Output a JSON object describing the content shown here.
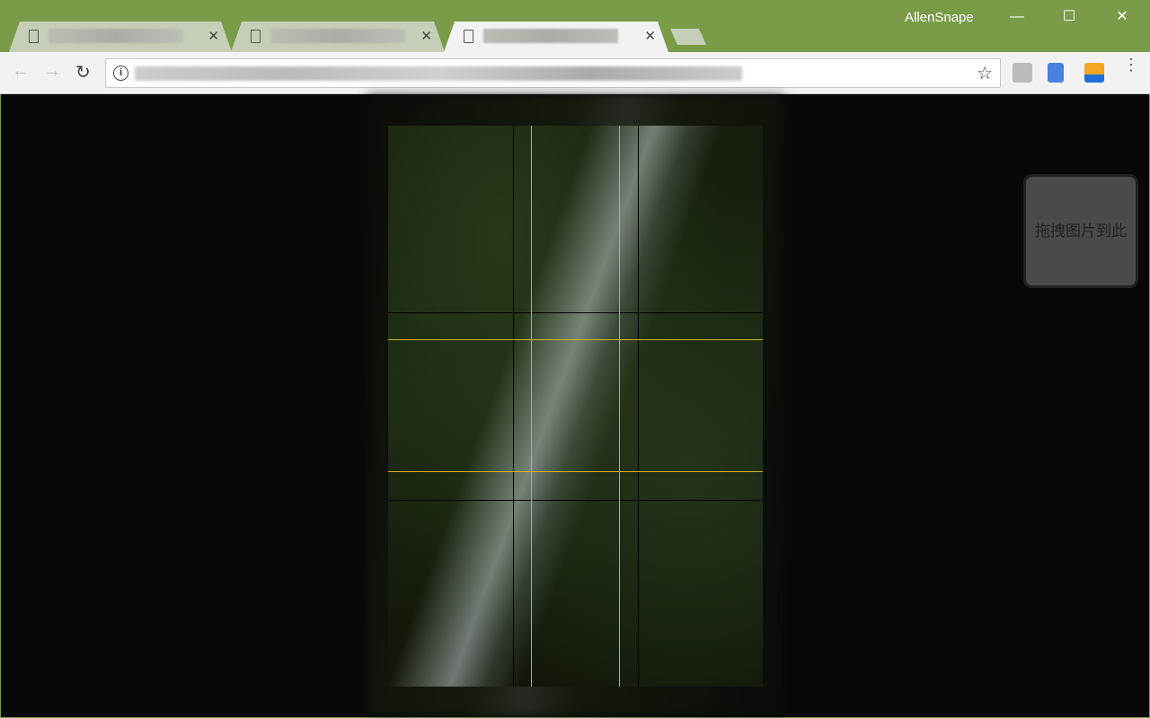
{
  "window": {
    "title": "AllenSnape",
    "controls": [
      "minimize",
      "maximize",
      "close"
    ]
  },
  "tabs": [
    {
      "label": "",
      "active": false
    },
    {
      "label": "",
      "active": false
    },
    {
      "label": "",
      "active": true
    }
  ],
  "toolbar": {
    "url": "",
    "extensions": [
      "image-extension-icon",
      "google-translate-icon",
      "as-extension-icon"
    ]
  },
  "overlay": {
    "grid": "rule-of-thirds",
    "grid_color": "#d6b21a"
  },
  "drop_zone": {
    "label": "拖拽图片到此"
  },
  "colors": {
    "frame": "#7a9c48",
    "toolbar": "#f2f2f2",
    "content_bg": "#080808"
  }
}
